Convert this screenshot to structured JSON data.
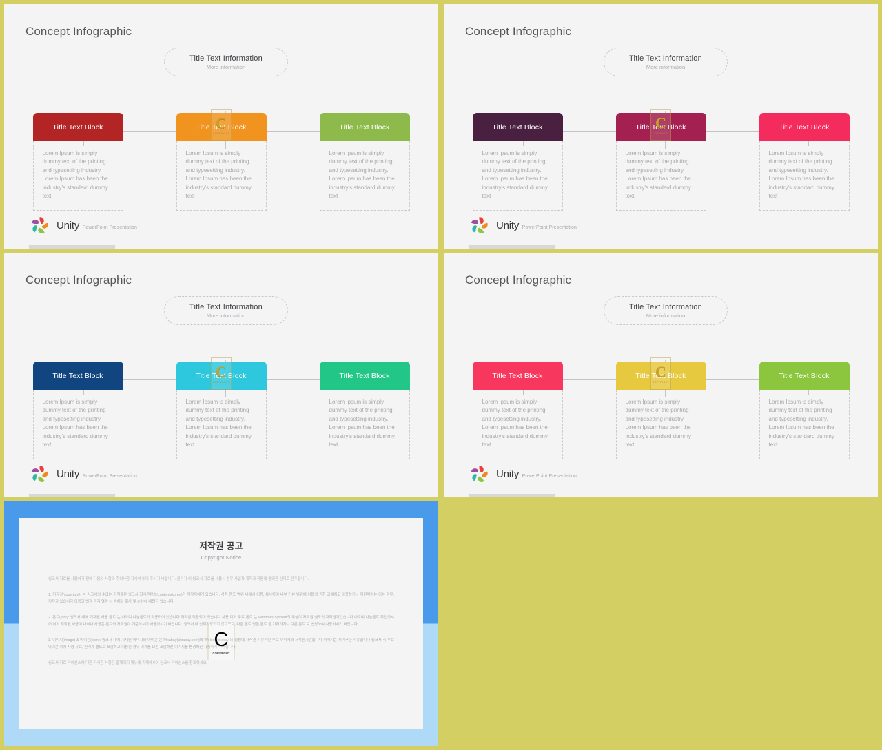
{
  "frame": {
    "background_color": "#d4cf62"
  },
  "slide_common": {
    "title": "Concept Infographic",
    "bubble": {
      "title": "Title  Text Information",
      "subtitle": "More information"
    },
    "block_title": "Title  Text Block",
    "block_body": "Lorem Ipsum is simply dummy text of the printing and typesetting industry. Lorem Ipsum has been the industry's standard dummy text",
    "logo": {
      "name": "Unity",
      "tagline": "PowerPoint Presentation",
      "icon": "unity-pinwheel-star-logo"
    },
    "watermark": {
      "letter": "C",
      "label": "COPYRIGHT"
    }
  },
  "slides": [
    {
      "id": "slide-1",
      "title": "Concept Infographic",
      "palette_name": "red-orange-green",
      "blocks": [
        {
          "label": "Title  Text Block",
          "color": "#b32424",
          "watermarked": false
        },
        {
          "label": "Title  Text Block",
          "color": "#f0941f",
          "watermarked": true
        },
        {
          "label": "Title  Text Block",
          "color": "#8dba4a",
          "watermarked": false
        }
      ]
    },
    {
      "id": "slide-2",
      "title": "Concept Infographic",
      "palette_name": "plum-wine-crimson",
      "blocks": [
        {
          "label": "Title  Text Block",
          "color": "#4a2040",
          "watermarked": false
        },
        {
          "label": "Title  Text Block",
          "color": "#a32050",
          "watermarked": true
        },
        {
          "label": "Title  Text Block",
          "color": "#f42c5d",
          "watermarked": false
        }
      ]
    },
    {
      "id": "slide-3",
      "title": "Concept Infographic",
      "palette_name": "navy-cyan-emerald",
      "blocks": [
        {
          "label": "Title  Text Block",
          "color": "#10457f",
          "watermarked": false
        },
        {
          "label": "Title  Text Block",
          "color": "#2ec8de",
          "watermarked": true
        },
        {
          "label": "Title  Text Block",
          "color": "#22c687",
          "watermarked": false
        }
      ]
    },
    {
      "id": "slide-4",
      "title": "Concept Infographic",
      "palette_name": "pink-gold-lime",
      "blocks": [
        {
          "label": "Title  Text Block",
          "color": "#f8375f",
          "watermarked": false
        },
        {
          "label": "Title  Text Block",
          "color": "#e7c93f",
          "watermarked": true
        },
        {
          "label": "Title  Text Block",
          "color": "#8cc63f",
          "watermarked": false
        }
      ]
    }
  ],
  "copyright_slide": {
    "frame_color_top": "#4a9aec",
    "frame_color_bottom": "#aed9f7",
    "title": "저작권 공고",
    "subtitle": "Copyright Notice",
    "paragraphs": [
      "씽크서 자료를 사용하기 전에 다음의 사항과 주의사항 자세히 읽어 주시기 바랍니다. 권리가 이 씽크서 자료를 사용시 경우 사업자 계약과 적용에 동의한 상태로 간주됩니다.",
      "1. 저작권(copyright): 본 씽크서의 수없는 저작물은 씽크서 회사콘텐츠(contentskorea)가 저작자에게 있습니다. 사적 용도 범위 내에서 이용, 복사하여 내부 기본 범위에 이들의 권한 교체하고 이용하거나 재판매하는 이는 경우, 저작권 있습니다 이용과 법적 권리 열람 시 손해와 회사 및 손상에 배합된 있습니다.",
      "2. 폰트(font): 씽크서 내에 기재된 사용 폰트 는 나오며 나눔폰트가 적용되어 있습니다 저작권 적용되어 있습니다 사용 이외 무료 폰트 는 Windows System의 무상이 저작권 별도의 저작권기간습니다 나오며 나눔폰트 확인하시어 이외 저작권 사용이 나이나 사용은 폰트와 저작권이 기준하시어 사용하시기 바랍니다. 씽크서 내 삽제적용되지 않으므로, 다른 폰트 명을 폰트 을 기재하거나 다른 폰트 로 변경하여 사용하시기 바랍니다.",
      "3. 이미지(image) & 아이콘(icon): 씽크서 내에 기재된 이미지와 아이콘 은 Pixabay(pixabay.com)와 Webkit(/pixbay)의 상용에 저작권 자유적인 무료 이미지와 저작권기간습니다 이미지는 시기구한 자유입니다 씽크서 측 무료아이콘 이에 사용 유료, 권리가 별도로 포함하고 이용한 경우 이가를 요청 포함하신 이미지를 변경하신 사용하시기 바랍니다.",
      "씽크서 자료 라이선스에 대한 자세한 사항은 홈페이지 메뉴에 기재하시어 씽크서 라이선스를 참조하세요."
    ]
  }
}
